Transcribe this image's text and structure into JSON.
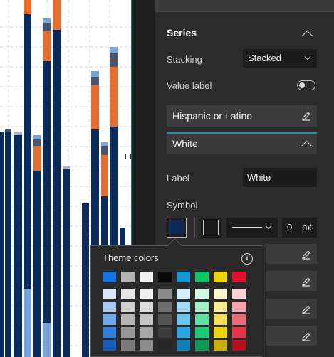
{
  "panel": {
    "section_title": "Series",
    "stacking_label": "Stacking",
    "stacking_value": "Stacked",
    "value_label_label": "Value label",
    "value_label_on": false,
    "series_items": [
      "Hispanic or Latino",
      "White"
    ],
    "label_label": "Label",
    "label_value": "White",
    "symbol_label": "Symbol",
    "symbol_fill": "#0b2b5c",
    "line_width": "0",
    "line_unit": "px"
  },
  "popup": {
    "title": "Theme colors",
    "info_icon": "i",
    "theme_row": [
      "#1473e6",
      "#b4b4b4",
      "#f0f0f0",
      "#0a0a0a",
      "#1597d5",
      "#0cc66a",
      "#f0d40a",
      "#e0102a"
    ],
    "shade_columns": [
      [
        "#dbe9fb",
        "#a8caf5",
        "#6ea8ee",
        "#2f7fe0",
        "#1b5bb8"
      ],
      [
        "#e6e6e6",
        "#cfcfcf",
        "#b4b4b4",
        "#979797",
        "#7a7a7a"
      ],
      [
        "#f0f0f0",
        "#dcdcdc",
        "#c4c4c4",
        "#a8a8a8",
        "#8c8c8c"
      ],
      [
        "#8a8a8a",
        "#6e6e6e",
        "#545454",
        "#3c3c3c",
        "#262626"
      ],
      [
        "#d4eefb",
        "#a4dbf6",
        "#6cc4ef",
        "#2aa6e2",
        "#0e7fb6"
      ],
      [
        "#d4f7e4",
        "#a4eec8",
        "#62e0a2",
        "#1ccb76",
        "#0a9a56"
      ],
      [
        "#fcf6cc",
        "#f8ec98",
        "#f4e060",
        "#f0d40a",
        "#c8ae06"
      ],
      [
        "#fbd4d8",
        "#f6a4ae",
        "#ef6a7a",
        "#e8324a",
        "#b80c22"
      ]
    ]
  },
  "colors": {
    "navy": "#0b2b5c",
    "orange": "#e46d2f",
    "slate": "#47566e",
    "lightblue": "#7aa3dc",
    "grey": "#aab2bd"
  }
}
